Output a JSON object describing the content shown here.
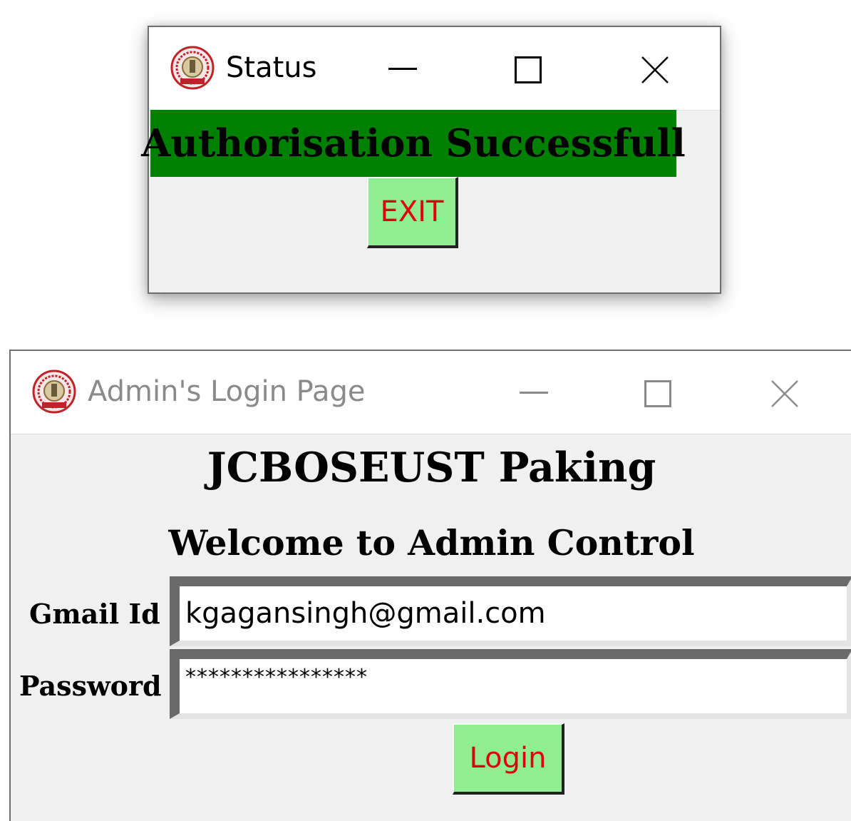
{
  "status_window": {
    "title": "Status",
    "icon": "university-emblem-icon",
    "message": "Authorisation Successfull",
    "message_bg": "#008000",
    "exit_label": "EXIT"
  },
  "login_window": {
    "title": "Admin's Login Page",
    "icon": "university-emblem-icon",
    "app_title": "JCBOSEUST Paking",
    "subtitle": "Welcome to Admin Control",
    "gmail_label": "Gmail Id",
    "gmail_value": "kgagansingh@gmail.com",
    "password_label": "Password",
    "password_value": "****************",
    "login_label": "Login"
  },
  "colors": {
    "button_bg": "#90ee90",
    "button_text": "#e0000a",
    "window_bg": "#f0f0f0"
  }
}
